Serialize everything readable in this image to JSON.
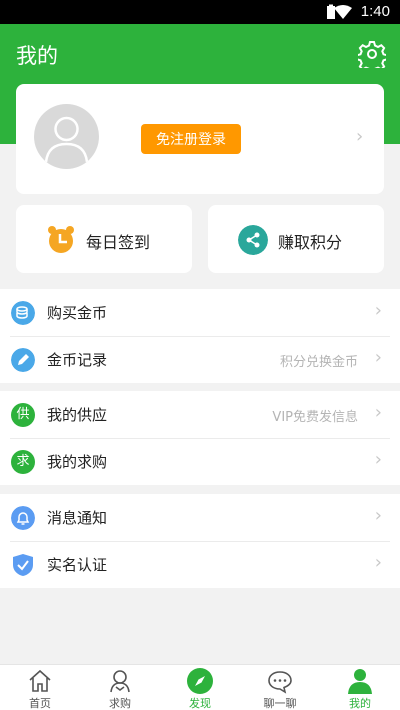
{
  "status_bar": {
    "time": "1:40"
  },
  "header": {
    "title": "我的"
  },
  "profile": {
    "login_label": "免注册登录"
  },
  "actions": [
    {
      "label": "每日签到",
      "icon": "alarm-clock-icon",
      "color": "#f5a623"
    },
    {
      "label": "赚取积分",
      "icon": "share-icon",
      "color": "#2aa79b"
    }
  ],
  "menu_groups": [
    [
      {
        "label": "购买金币",
        "hint": "",
        "icon": "coins-icon",
        "color": "#4aa8e8"
      },
      {
        "label": "金币记录",
        "hint": "积分兑换金币",
        "icon": "pencil-icon",
        "color": "#4aa8e8"
      }
    ],
    [
      {
        "label": "我的供应",
        "hint": "VIP免费发信息",
        "icon": "supply-icon",
        "glyph": "供",
        "color": "#2db23c"
      },
      {
        "label": "我的求购",
        "hint": "",
        "icon": "purchase-icon",
        "glyph": "求",
        "color": "#2db23c"
      }
    ],
    [
      {
        "label": "消息通知",
        "hint": "",
        "icon": "bell-icon",
        "color": "#5b9cf2"
      },
      {
        "label": "实名认证",
        "hint": "",
        "icon": "shield-check-icon",
        "color": "#5b9cf2"
      }
    ]
  ],
  "tabs": [
    {
      "label": "首页",
      "icon": "home-icon"
    },
    {
      "label": "求购",
      "icon": "buyer-icon"
    },
    {
      "label": "发现",
      "icon": "compass-icon"
    },
    {
      "label": "聊一聊",
      "icon": "chat-icon"
    },
    {
      "label": "我的",
      "icon": "person-icon"
    }
  ],
  "active_tab": "我的",
  "colors": {
    "brand_green": "#2db23c",
    "login_orange": "#ff9800"
  }
}
